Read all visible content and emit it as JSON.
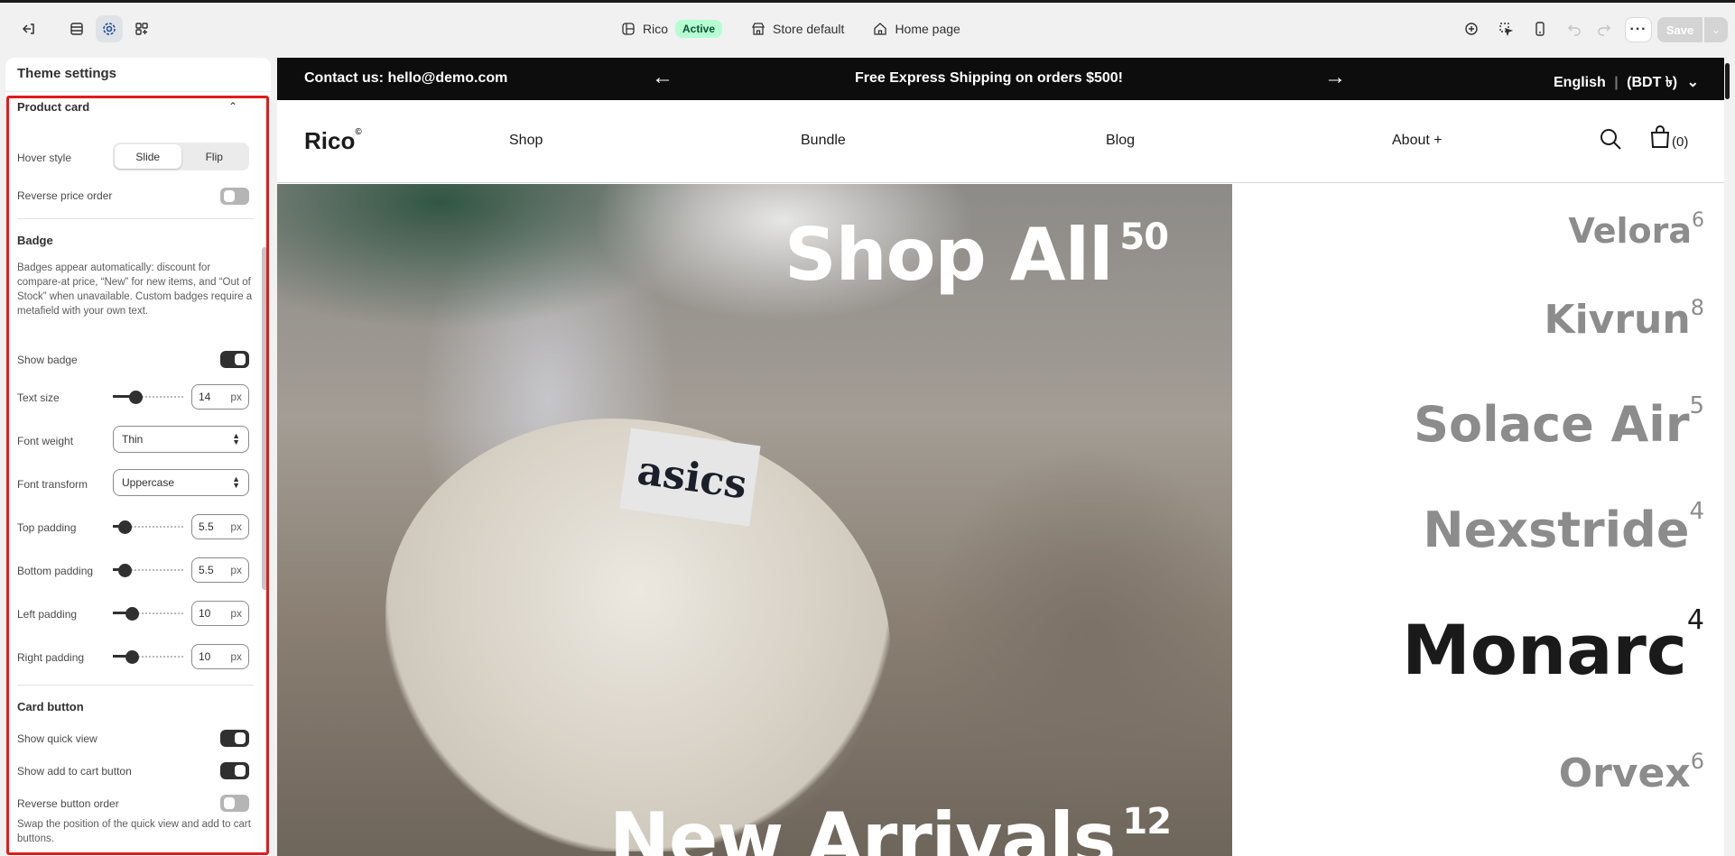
{
  "topbar": {
    "theme_name": "Rico",
    "status": "Active",
    "store": "Store default",
    "page": "Home page",
    "save_label": "Save"
  },
  "sidebar": {
    "header": "Theme settings",
    "section_title": "Product card",
    "hover_style": {
      "label": "Hover style",
      "options": [
        "Slide",
        "Flip"
      ],
      "selected": "Slide"
    },
    "reverse_price": {
      "label": "Reverse price order",
      "on": false
    },
    "badge": {
      "title": "Badge",
      "description": "Badges appear automatically: discount for compare-at price, “New” for new items, and “Out of Stock” when unavailable. Custom badges require a metafield with your own text.",
      "show_badge": {
        "label": "Show badge",
        "on": true
      },
      "text_size": {
        "label": "Text size",
        "value": "14",
        "unit": "px"
      },
      "font_weight": {
        "label": "Font weight",
        "value": "Thin"
      },
      "font_transform": {
        "label": "Font transform",
        "value": "Uppercase"
      },
      "top_padding": {
        "label": "Top padding",
        "value": "5.5",
        "unit": "px"
      },
      "bottom_padding": {
        "label": "Bottom padding",
        "value": "5.5",
        "unit": "px"
      },
      "left_padding": {
        "label": "Left padding",
        "value": "10",
        "unit": "px"
      },
      "right_padding": {
        "label": "Right padding",
        "value": "10",
        "unit": "px"
      }
    },
    "card_button": {
      "title": "Card button",
      "show_quick_view": {
        "label": "Show quick view",
        "on": true
      },
      "show_add_to_cart": {
        "label": "Show add to cart button",
        "on": true
      },
      "reverse_order": {
        "label": "Reverse button order",
        "on": false
      },
      "note": "Swap the position of the quick view and add to cart buttons."
    }
  },
  "preview": {
    "announcement": {
      "contact": "Contact us: hello@demo.com",
      "message": "Free Express Shipping on orders $500!",
      "language": "English",
      "currency": "(BDT ৳)"
    },
    "header": {
      "logo": "Rico",
      "logo_mark": "©",
      "nav": [
        "Shop",
        "Bundle",
        "Blog",
        "About +"
      ],
      "cart_count": "(0)"
    },
    "hero": {
      "title1": "Shop All",
      "title1_count": "50",
      "title2": "New Arrivals",
      "title2_count": "12",
      "shoe_brand": "asics"
    },
    "categories": [
      {
        "name": "Velora",
        "count": "6"
      },
      {
        "name": "Kivrun",
        "count": "8"
      },
      {
        "name": "Solace Air",
        "count": "5"
      },
      {
        "name": "Nexstride",
        "count": "4"
      },
      {
        "name": "Monarc",
        "count": "4"
      },
      {
        "name": "Orvex",
        "count": "6"
      }
    ]
  }
}
